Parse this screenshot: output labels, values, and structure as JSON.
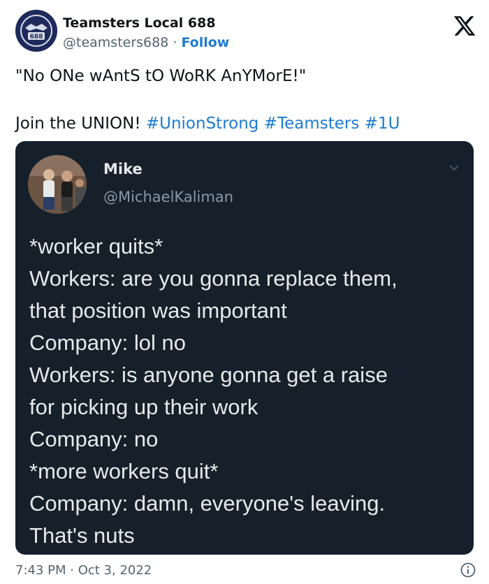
{
  "author": {
    "name": "Teamsters Local 688",
    "handle": "@teamsters688",
    "separator": " · ",
    "follow_label": "Follow",
    "avatar_icon": "teamsters-emblem",
    "avatar_badge": "688"
  },
  "tweet": {
    "line1": "\"No ONe wAntS tO WoRK AnYMorE!\"",
    "line2_prefix": "Join the UNION! ",
    "hashtags": [
      "#UnionStrong",
      "#Teamsters",
      "#1U"
    ]
  },
  "embedded": {
    "name": "Mike",
    "handle": "@MichaelKaliman",
    "lines": [
      "*worker quits*",
      "Workers: are you gonna replace them,",
      "that position was important",
      "Company: lol no",
      "Workers: is anyone gonna get a raise",
      "for picking up their work",
      "Company: no",
      "*more workers quit*",
      "Company: damn, everyone's leaving.",
      "That's nuts"
    ]
  },
  "footer": {
    "time": "7:43 PM",
    "separator": " · ",
    "date": "Oct 3, 2022"
  },
  "colors": {
    "link": "#1d7bd0",
    "embed_background": "#15202b",
    "muted": "#536471"
  },
  "icons": [
    "x-logo-icon",
    "chevron-down-icon",
    "info-icon"
  ]
}
